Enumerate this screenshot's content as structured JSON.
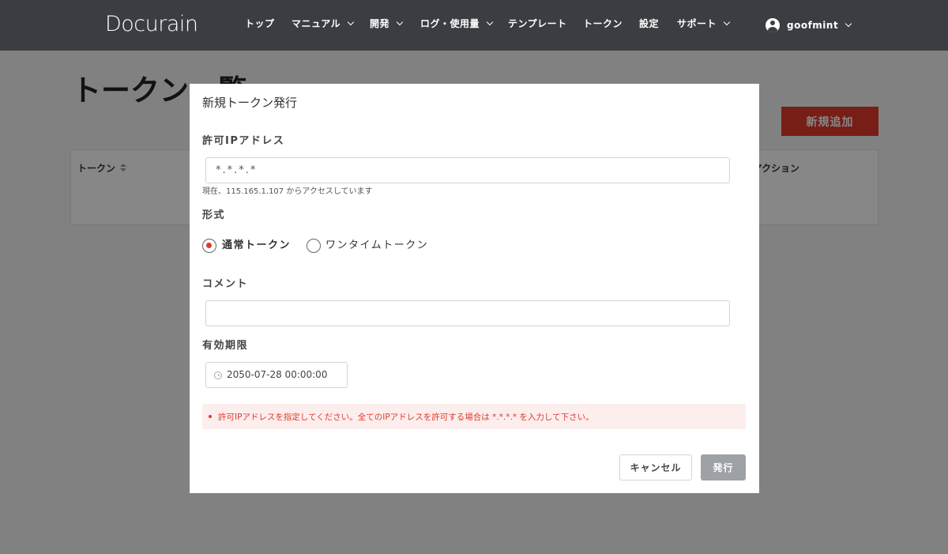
{
  "navbar": {
    "logo": "Docurain",
    "items": [
      {
        "label": "トップ",
        "has_dropdown": false
      },
      {
        "label": "マニュアル",
        "has_dropdown": true
      },
      {
        "label": "開発",
        "has_dropdown": true
      },
      {
        "label": "ログ・使用量",
        "has_dropdown": true
      },
      {
        "label": "テンプレート",
        "has_dropdown": false
      },
      {
        "label": "トークン",
        "has_dropdown": false
      },
      {
        "label": "設定",
        "has_dropdown": false
      },
      {
        "label": "サポート",
        "has_dropdown": true
      }
    ],
    "user": {
      "name": "goofmint",
      "icon": "user-circle-icon"
    }
  },
  "page": {
    "title": "トークン一覧",
    "add_button": "新規追加",
    "table": {
      "columns": [
        "トークン",
        "アクション"
      ]
    }
  },
  "modal": {
    "title": "新規トークン発行",
    "ip": {
      "label": "許可IPアドレス",
      "value": "*.*.*.*",
      "help": "現在、115.165.1.107 からアクセスしています"
    },
    "format": {
      "label": "形式",
      "options": [
        {
          "label": "通常トークン",
          "checked": true
        },
        {
          "label": "ワンタイムトークン",
          "checked": false
        }
      ]
    },
    "comment": {
      "label": "コメント",
      "value": ""
    },
    "expiry": {
      "label": "有効期限",
      "value": "2050-07-28 00:00:00",
      "icon": "clock-icon"
    },
    "error": "許可IPアドレスを指定してください。全てのIPアドレスを許可する場合は *.*.*.* を入力して下さい。",
    "cancel_button": "キャンセル",
    "submit_button": "発行"
  },
  "colors": {
    "navbar_bg": "#3a3d41",
    "accent_red": "#e0392b",
    "disabled_button": "#9ea1a5",
    "error_bg": "#fdeeee"
  }
}
